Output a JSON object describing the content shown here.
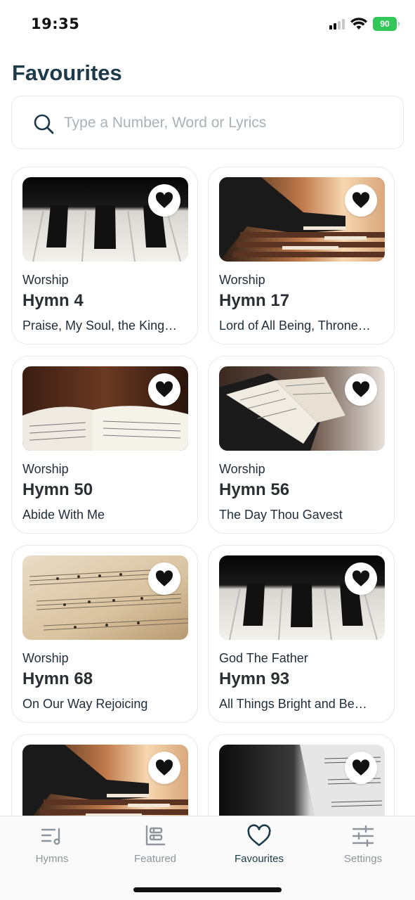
{
  "status": {
    "time": "19:35",
    "battery": "90"
  },
  "page": {
    "title": "Favourites"
  },
  "search": {
    "placeholder": "Type a Number, Word or Lyrics",
    "value": ""
  },
  "cards": [
    {
      "category": "Worship",
      "hymn": "Hymn 4",
      "title": "Praise, My Soul, the King…",
      "image": "piano-keys"
    },
    {
      "category": "Worship",
      "hymn": "Hymn 17",
      "title": "Lord of All Being, Throne…",
      "image": "organ-player"
    },
    {
      "category": "Worship",
      "hymn": "Hymn 50",
      "title": "Abide With Me",
      "image": "open-hymnal"
    },
    {
      "category": "Worship",
      "hymn": "Hymn 56",
      "title": "The Day Thou Gavest",
      "image": "hymnal-on-stand"
    },
    {
      "category": "Worship",
      "hymn": "Hymn 68",
      "title": "On Our Way Rejoicing",
      "image": "sheet-music"
    },
    {
      "category": "God The Father",
      "hymn": "Hymn 93",
      "title": "All Things Bright and Be…",
      "image": "piano-keys"
    },
    {
      "category": "",
      "hymn": "",
      "title": "",
      "image": "organ-player"
    },
    {
      "category": "",
      "hymn": "",
      "title": "",
      "image": "sheet-music-bw"
    }
  ],
  "tabs": [
    {
      "label": "Hymns",
      "icon": "hymns-icon"
    },
    {
      "label": "Featured",
      "icon": "featured-icon"
    },
    {
      "label": "Favourites",
      "icon": "heart-icon",
      "active": true
    },
    {
      "label": "Settings",
      "icon": "settings-sliders-icon"
    }
  ],
  "colors": {
    "primary": "#1c3a4a",
    "inactive": "#8e959c",
    "battery": "#33c759"
  }
}
